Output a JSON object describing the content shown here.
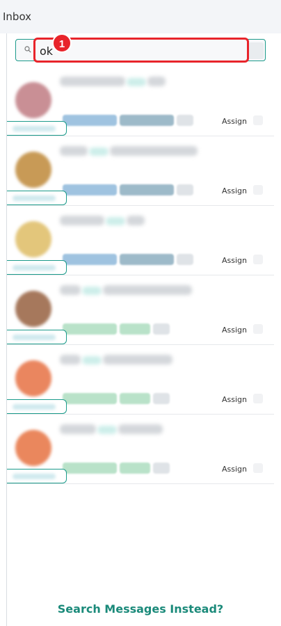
{
  "header": {
    "title": "Inbox"
  },
  "search": {
    "value": "ok",
    "placeholder": ""
  },
  "annotation": {
    "badge_number": "1"
  },
  "colors": {
    "accent": "#1a9a8a",
    "highlight": "#e8242b",
    "blue_chip": "#9fc3e0",
    "green_chip": "#b9e2c9",
    "gray_chip": "#dfe3e7"
  },
  "conversations": [
    {
      "assign_label": "Assign",
      "avatar_color": "#c98f95",
      "chip_style": "blue"
    },
    {
      "assign_label": "Assign",
      "avatar_color": "#c89a56",
      "chip_style": "blue"
    },
    {
      "assign_label": "Assign",
      "avatar_color": "#e3c67b",
      "chip_style": "blue"
    },
    {
      "assign_label": "Assign",
      "avatar_color": "#a6785c",
      "chip_style": "green"
    },
    {
      "assign_label": "Assign",
      "avatar_color": "#ea865f",
      "chip_style": "green"
    },
    {
      "assign_label": "Assign",
      "avatar_color": "#ea875d",
      "chip_style": "green"
    }
  ],
  "footer": {
    "search_messages_label": "Search Messages Instead?"
  }
}
